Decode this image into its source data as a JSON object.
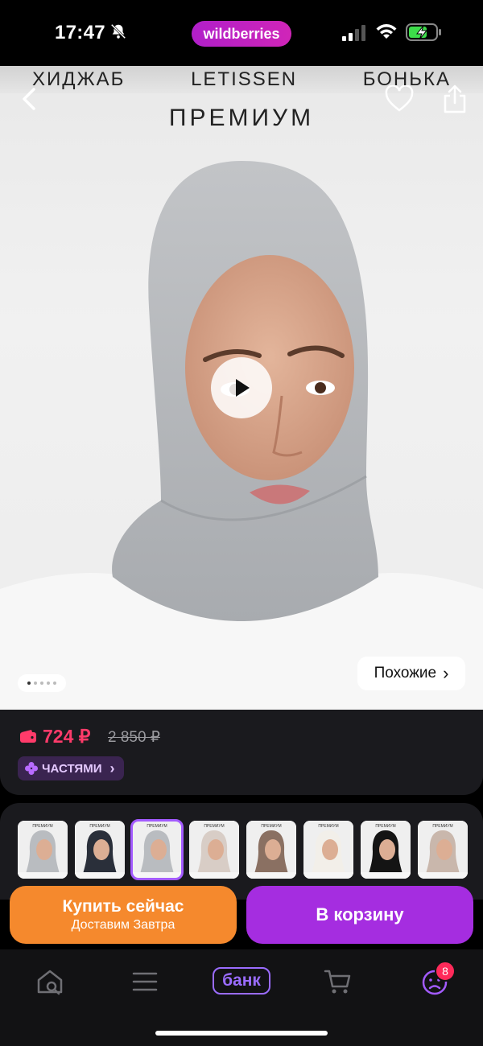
{
  "status_bar": {
    "time": "17:47",
    "brand_pill": "wildberries",
    "icons": [
      "bell-muted-icon",
      "cellular-signal-icon",
      "wifi-icon",
      "battery-charging-icon"
    ]
  },
  "hero": {
    "banner_words": [
      "ХИДЖАБ",
      "LETISSEN",
      "БОНЬКА"
    ],
    "banner_title": "ПРЕМИУМ",
    "similar_label": "Похожие",
    "similar_chevron": "›",
    "gallery_dots": 5,
    "gallery_active_dot": 1
  },
  "price": {
    "current": "724 ₽",
    "old": "2 850 ₽",
    "installments_label": "ЧАСТЯМИ",
    "installments_chevron": "›",
    "accent_color": "#ff3b6a"
  },
  "thumbnails": [
    {
      "caption": "ПРЕМИУМ",
      "hijab_color": "#b9bcc0",
      "selected": false
    },
    {
      "caption": "ПРЕМИУМ",
      "hijab_color": "#2a2f3a",
      "selected": false
    },
    {
      "caption": "ПРЕМИУМ",
      "hijab_color": "#b9bcc0",
      "selected": true
    },
    {
      "caption": "ПРЕМИУМ",
      "hijab_color": "#d8cdc6",
      "selected": false
    },
    {
      "caption": "ПРЕМИУМ",
      "hijab_color": "#8a7062",
      "selected": false
    },
    {
      "caption": "ПРЕМИУМ",
      "hijab_color": "#f2efe9",
      "selected": false
    },
    {
      "caption": "ПРЕМИУМ",
      "hijab_color": "#141414",
      "selected": false
    },
    {
      "caption": "ПРЕМИУМ",
      "hijab_color": "#c9b7ac",
      "selected": false
    }
  ],
  "actions": {
    "buy_now": "Купить сейчас",
    "buy_now_sub": "Доставим Завтра",
    "add_to_cart": "В корзину"
  },
  "tabbar": {
    "bank_label": "банк",
    "profile_badge": "8"
  }
}
